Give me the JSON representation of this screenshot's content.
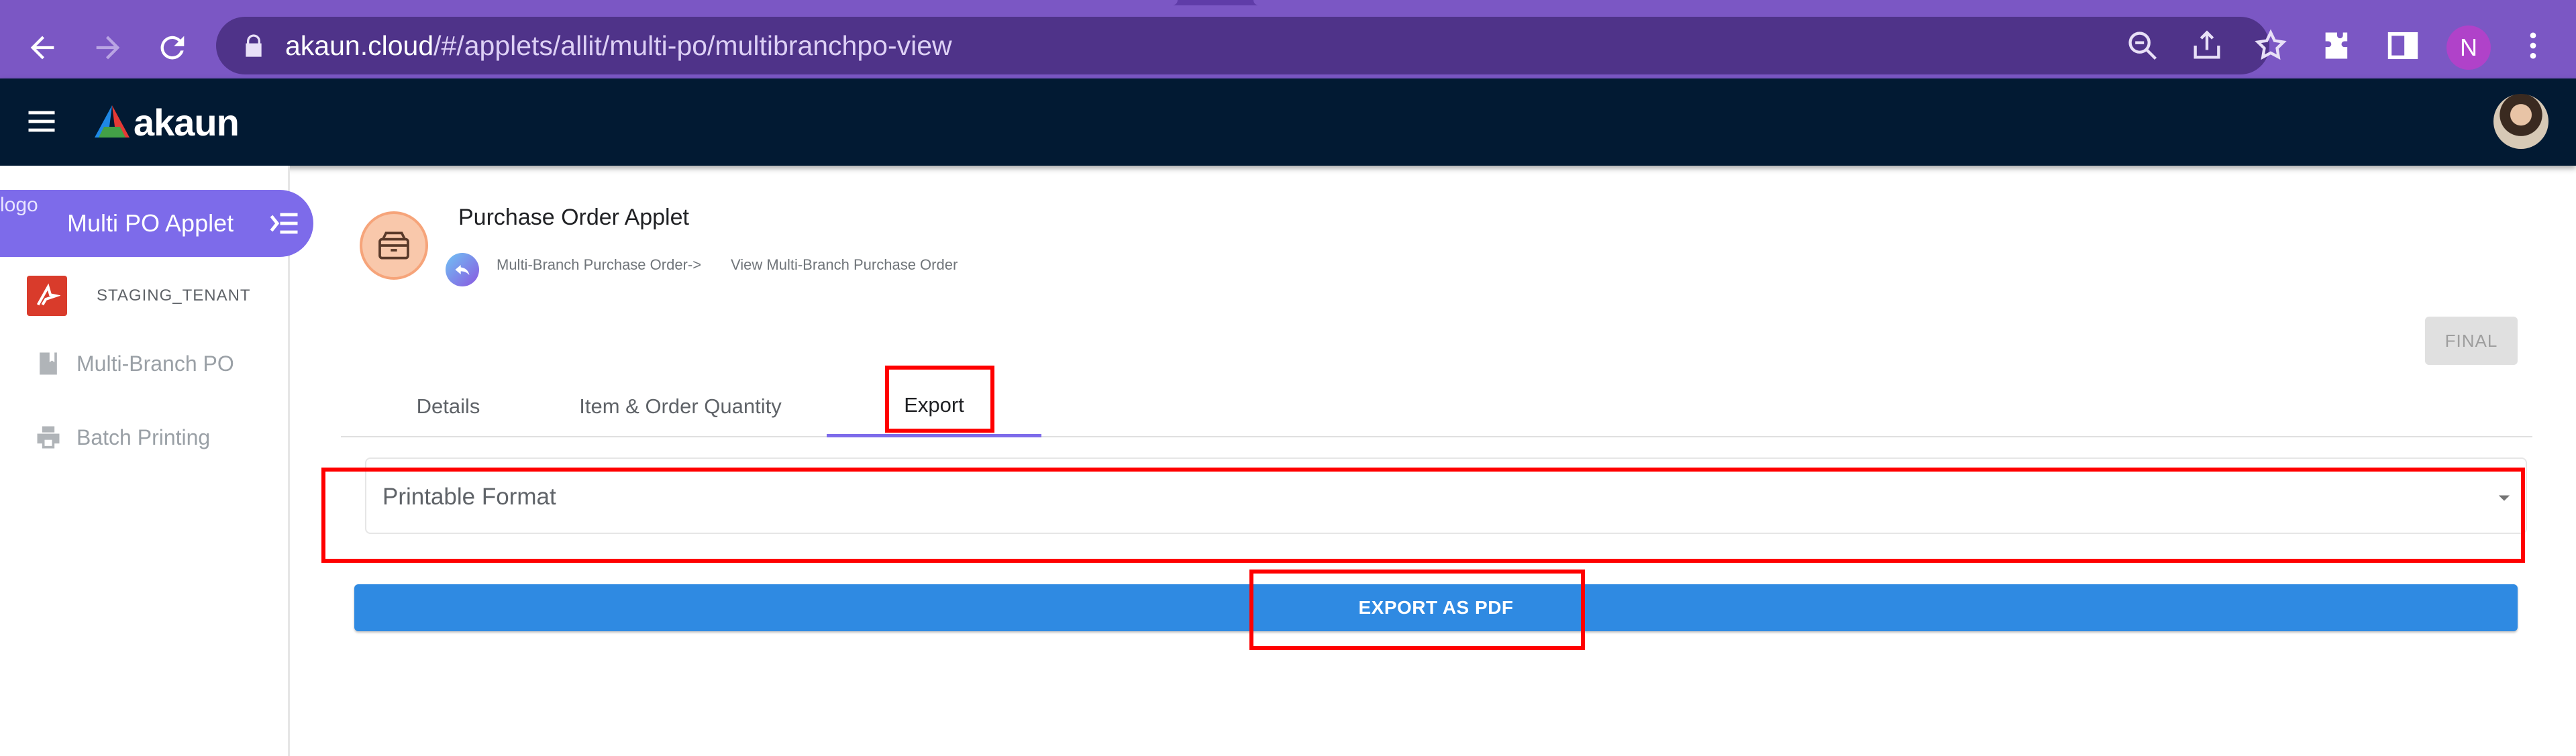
{
  "browser": {
    "url_host": "akaun.cloud",
    "url_path": "/#/applets/allit/multi-po/multibranchpo-view",
    "profile_initial": "N"
  },
  "app": {
    "brand": "akaun"
  },
  "sidebar": {
    "applet_title": "Multi PO Applet",
    "logo_alt": "logo",
    "tenant": "STAGING_TENANT",
    "items": [
      {
        "label": "Multi-Branch PO"
      },
      {
        "label": "Batch Printing"
      }
    ]
  },
  "main": {
    "title": "Purchase Order Applet",
    "breadcrumb": [
      "Multi-Branch Purchase Order->",
      "View Multi-Branch Purchase Order"
    ],
    "status_button": "FINAL",
    "tabs": [
      {
        "label": "Details"
      },
      {
        "label": "Item & Order Quantity"
      },
      {
        "label": "Export"
      }
    ],
    "active_tab": "Export",
    "format_select": {
      "placeholder": "Printable Format"
    },
    "export_button": "EXPORT AS PDF"
  },
  "colors": {
    "browser_toolbar": "#7b57c4",
    "app_header": "#021a33",
    "accent": "#7d6bea",
    "primary_button": "#2f8ae2",
    "annotation": "#ff0000"
  }
}
